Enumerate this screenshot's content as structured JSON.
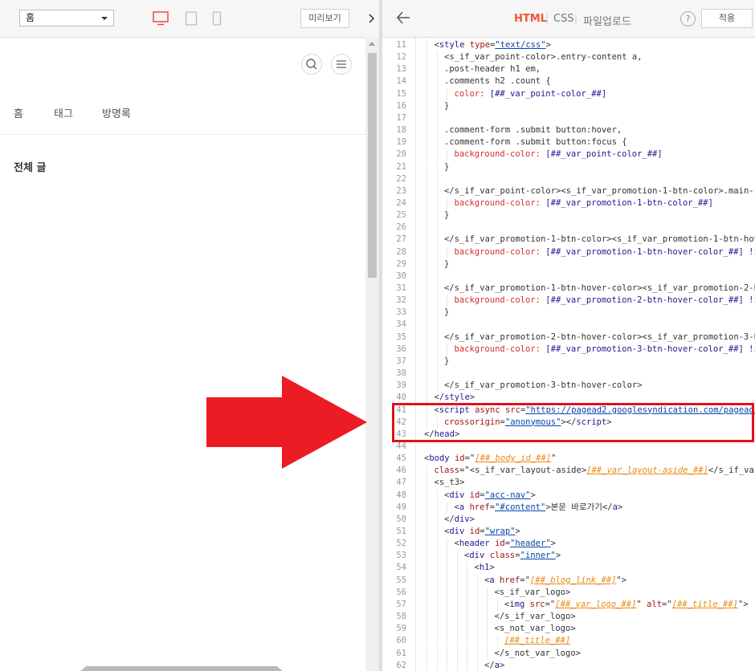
{
  "left": {
    "page_select": "홈",
    "preview_label": "미리보기",
    "nav": [
      "홈",
      "태그",
      "방명록"
    ],
    "section_title": "전체 글"
  },
  "right": {
    "tabs": [
      "HTML",
      "CSS",
      "파일업로드"
    ],
    "help": "?",
    "apply_label": "적용"
  },
  "code": {
    "lines": [
      {
        "n": "11",
        "ind": 1,
        "segs": [
          [
            "k",
            "<"
          ],
          [
            "t",
            "style"
          ],
          [
            "k",
            " "
          ],
          [
            "a",
            "type"
          ],
          [
            "k",
            "="
          ],
          [
            "s",
            "\"text/css\""
          ],
          [
            "k",
            ">"
          ]
        ]
      },
      {
        "n": "12",
        "ind": 2,
        "segs": [
          [
            "k",
            "<s_if_var_point-color>.entry-content a,"
          ]
        ]
      },
      {
        "n": "13",
        "ind": 2,
        "segs": [
          [
            "k",
            ".post-header h1 em,"
          ]
        ]
      },
      {
        "n": "14",
        "ind": 2,
        "segs": [
          [
            "k",
            ".comments h2 .count {"
          ]
        ]
      },
      {
        "n": "15",
        "ind": 3,
        "segs": [
          [
            "p",
            "color:"
          ],
          [
            "k",
            " "
          ],
          [
            "pv",
            "[##_var_point-color_##]"
          ]
        ]
      },
      {
        "n": "16",
        "ind": 2,
        "segs": [
          [
            "k",
            "}"
          ]
        ]
      },
      {
        "n": "17",
        "ind": 2,
        "segs": []
      },
      {
        "n": "18",
        "ind": 2,
        "segs": [
          [
            "k",
            ".comment-form .submit button:hover,"
          ]
        ]
      },
      {
        "n": "19",
        "ind": 2,
        "segs": [
          [
            "k",
            ".comment-form .submit button:focus {"
          ]
        ]
      },
      {
        "n": "20",
        "ind": 3,
        "segs": [
          [
            "p",
            "background-color:"
          ],
          [
            "k",
            " "
          ],
          [
            "pv",
            "[##_var_point-color_##]"
          ]
        ]
      },
      {
        "n": "21",
        "ind": 2,
        "segs": [
          [
            "k",
            "}"
          ]
        ]
      },
      {
        "n": "22",
        "ind": 2,
        "segs": []
      },
      {
        "n": "23",
        "ind": 2,
        "segs": [
          [
            "k",
            "</s_if_var_point-color><s_if_var_promotion-1-btn-color>.main-sli"
          ]
        ]
      },
      {
        "n": "24",
        "ind": 3,
        "segs": [
          [
            "p",
            "background-color:"
          ],
          [
            "k",
            " "
          ],
          [
            "pv",
            "[##_var_promotion-1-btn-color_##]"
          ]
        ]
      },
      {
        "n": "25",
        "ind": 2,
        "segs": [
          [
            "k",
            "}"
          ]
        ]
      },
      {
        "n": "26",
        "ind": 2,
        "segs": []
      },
      {
        "n": "27",
        "ind": 2,
        "segs": [
          [
            "k",
            "</s_if_var_promotion-1-btn-color><s_if_var_promotion-1-btn-hover"
          ]
        ]
      },
      {
        "n": "28",
        "ind": 3,
        "segs": [
          [
            "p",
            "background-color:"
          ],
          [
            "k",
            " "
          ],
          [
            "pv",
            "[##_var_promotion-1-btn-hover-color_##] !im"
          ]
        ]
      },
      {
        "n": "29",
        "ind": 2,
        "segs": [
          [
            "k",
            "}"
          ]
        ]
      },
      {
        "n": "30",
        "ind": 2,
        "segs": []
      },
      {
        "n": "31",
        "ind": 2,
        "segs": [
          [
            "k",
            "</s_if_var_promotion-1-btn-hover-color><s_if_var_promotion-2-bt"
          ]
        ]
      },
      {
        "n": "32",
        "ind": 3,
        "segs": [
          [
            "p",
            "background-color:"
          ],
          [
            "k",
            " "
          ],
          [
            "pv",
            "[##_var_promotion-2-btn-hover-color_##] !im"
          ]
        ]
      },
      {
        "n": "33",
        "ind": 2,
        "segs": [
          [
            "k",
            "}"
          ]
        ]
      },
      {
        "n": "34",
        "ind": 2,
        "segs": []
      },
      {
        "n": "35",
        "ind": 2,
        "segs": [
          [
            "k",
            "</s_if_var_promotion-2-btn-hover-color><s_if_var_promotion-3-bt"
          ]
        ]
      },
      {
        "n": "36",
        "ind": 3,
        "segs": [
          [
            "p",
            "background-color:"
          ],
          [
            "k",
            " "
          ],
          [
            "pv",
            "[##_var_promotion-3-btn-hover-color_##] !im"
          ]
        ]
      },
      {
        "n": "37",
        "ind": 2,
        "segs": [
          [
            "k",
            "}"
          ]
        ]
      },
      {
        "n": "38",
        "ind": 2,
        "segs": []
      },
      {
        "n": "39",
        "ind": 2,
        "segs": [
          [
            "k",
            "</s_if_var_promotion-3-btn-hover-color>"
          ]
        ]
      },
      {
        "n": "40",
        "ind": 1,
        "segs": [
          [
            "k",
            "</"
          ],
          [
            "t",
            "style"
          ],
          [
            "k",
            ">"
          ]
        ]
      },
      {
        "n": "41",
        "ind": 1,
        "segs": [
          [
            "k",
            "<"
          ],
          [
            "t",
            "script"
          ],
          [
            "k",
            " "
          ],
          [
            "a",
            "async"
          ],
          [
            "k",
            " "
          ],
          [
            "a",
            "src"
          ],
          [
            "k",
            "="
          ],
          [
            "s",
            "\"https://pagead2.googlesyndication.com/pagead/j"
          ]
        ]
      },
      {
        "n": "42",
        "ind": 2,
        "segs": [
          [
            "a",
            "crossorigin"
          ],
          [
            "k",
            "="
          ],
          [
            "s",
            "\"anonymous\""
          ],
          [
            "k",
            "></"
          ],
          [
            "t",
            "script"
          ],
          [
            "k",
            ">"
          ]
        ]
      },
      {
        "n": "43",
        "ind": 0,
        "segs": [
          [
            "k",
            "</"
          ],
          [
            "t",
            "head"
          ],
          [
            "k",
            ">"
          ]
        ]
      },
      {
        "n": "44",
        "ind": 0,
        "segs": []
      },
      {
        "n": "45",
        "ind": 0,
        "segs": [
          [
            "k",
            "<"
          ],
          [
            "t",
            "body"
          ],
          [
            "k",
            " "
          ],
          [
            "a",
            "id"
          ],
          [
            "k",
            "=\""
          ],
          [
            "v",
            "[##_body_id_##]"
          ],
          [
            "k",
            "\""
          ]
        ]
      },
      {
        "n": "46",
        "ind": 1,
        "segs": [
          [
            "a",
            "class"
          ],
          [
            "k",
            "=\"<s_if_var_layout-aside>"
          ],
          [
            "v",
            "[##_var_layout-aside_##]"
          ],
          [
            "k",
            "</s_if_var_"
          ]
        ]
      },
      {
        "n": "47",
        "ind": 1,
        "segs": [
          [
            "k",
            "<s_t3>"
          ]
        ]
      },
      {
        "n": "48",
        "ind": 2,
        "segs": [
          [
            "k",
            "<"
          ],
          [
            "t",
            "div"
          ],
          [
            "k",
            " "
          ],
          [
            "a",
            "id"
          ],
          [
            "k",
            "="
          ],
          [
            "s",
            "\"acc-nav\""
          ],
          [
            "k",
            ">"
          ]
        ]
      },
      {
        "n": "49",
        "ind": 3,
        "segs": [
          [
            "k",
            "<"
          ],
          [
            "t",
            "a"
          ],
          [
            "k",
            " "
          ],
          [
            "a",
            "href"
          ],
          [
            "k",
            "="
          ],
          [
            "s",
            "\"#content\""
          ],
          [
            "k",
            ">본문 바로가기</"
          ],
          [
            "t",
            "a"
          ],
          [
            "k",
            ">"
          ]
        ]
      },
      {
        "n": "50",
        "ind": 2,
        "segs": [
          [
            "k",
            "</"
          ],
          [
            "t",
            "div"
          ],
          [
            "k",
            ">"
          ]
        ]
      },
      {
        "n": "51",
        "ind": 2,
        "segs": [
          [
            "k",
            "<"
          ],
          [
            "t",
            "div"
          ],
          [
            "k",
            " "
          ],
          [
            "a",
            "id"
          ],
          [
            "k",
            "="
          ],
          [
            "s",
            "\"wrap\""
          ],
          [
            "k",
            ">"
          ]
        ]
      },
      {
        "n": "52",
        "ind": 3,
        "segs": [
          [
            "k",
            "<"
          ],
          [
            "t",
            "header"
          ],
          [
            "k",
            " "
          ],
          [
            "a",
            "id"
          ],
          [
            "k",
            "="
          ],
          [
            "s",
            "\"header\""
          ],
          [
            "k",
            ">"
          ]
        ]
      },
      {
        "n": "53",
        "ind": 4,
        "segs": [
          [
            "k",
            "<"
          ],
          [
            "t",
            "div"
          ],
          [
            "k",
            " "
          ],
          [
            "a",
            "class"
          ],
          [
            "k",
            "="
          ],
          [
            "s",
            "\"inner\""
          ],
          [
            "k",
            ">"
          ]
        ]
      },
      {
        "n": "54",
        "ind": 5,
        "segs": [
          [
            "k",
            "<"
          ],
          [
            "t",
            "h1"
          ],
          [
            "k",
            ">"
          ]
        ]
      },
      {
        "n": "55",
        "ind": 6,
        "segs": [
          [
            "k",
            "<"
          ],
          [
            "t",
            "a"
          ],
          [
            "k",
            " "
          ],
          [
            "a",
            "href"
          ],
          [
            "k",
            "=\""
          ],
          [
            "v",
            "[##_blog_link_##]"
          ],
          [
            "k",
            "\">"
          ]
        ]
      },
      {
        "n": "56",
        "ind": 7,
        "segs": [
          [
            "k",
            "<s_if_var_logo>"
          ]
        ]
      },
      {
        "n": "57",
        "ind": 8,
        "segs": [
          [
            "k",
            "<"
          ],
          [
            "t",
            "img"
          ],
          [
            "k",
            " "
          ],
          [
            "a",
            "src"
          ],
          [
            "k",
            "=\""
          ],
          [
            "v",
            "[##_var_logo_##]"
          ],
          [
            "k",
            "\" "
          ],
          [
            "a",
            "alt"
          ],
          [
            "k",
            "=\""
          ],
          [
            "v",
            "[##_title_##]"
          ],
          [
            "k",
            "\">"
          ]
        ]
      },
      {
        "n": "58",
        "ind": 7,
        "segs": [
          [
            "k",
            "</s_if_var_logo>"
          ]
        ]
      },
      {
        "n": "59",
        "ind": 7,
        "segs": [
          [
            "k",
            "<s_not_var_logo>"
          ]
        ]
      },
      {
        "n": "60",
        "ind": 8,
        "segs": [
          [
            "v",
            "[##_title_##]"
          ]
        ]
      },
      {
        "n": "61",
        "ind": 7,
        "segs": [
          [
            "k",
            "</s_not_var_logo>"
          ]
        ]
      },
      {
        "n": "62",
        "ind": 6,
        "segs": [
          [
            "k",
            "</"
          ],
          [
            "t",
            "a"
          ],
          [
            "k",
            ">"
          ]
        ]
      }
    ]
  },
  "colors": {
    "accent": "#f05532",
    "highlight_box": "#e1111b",
    "arrow": "#ec1c24",
    "desktop_icon": "#e8484b"
  }
}
